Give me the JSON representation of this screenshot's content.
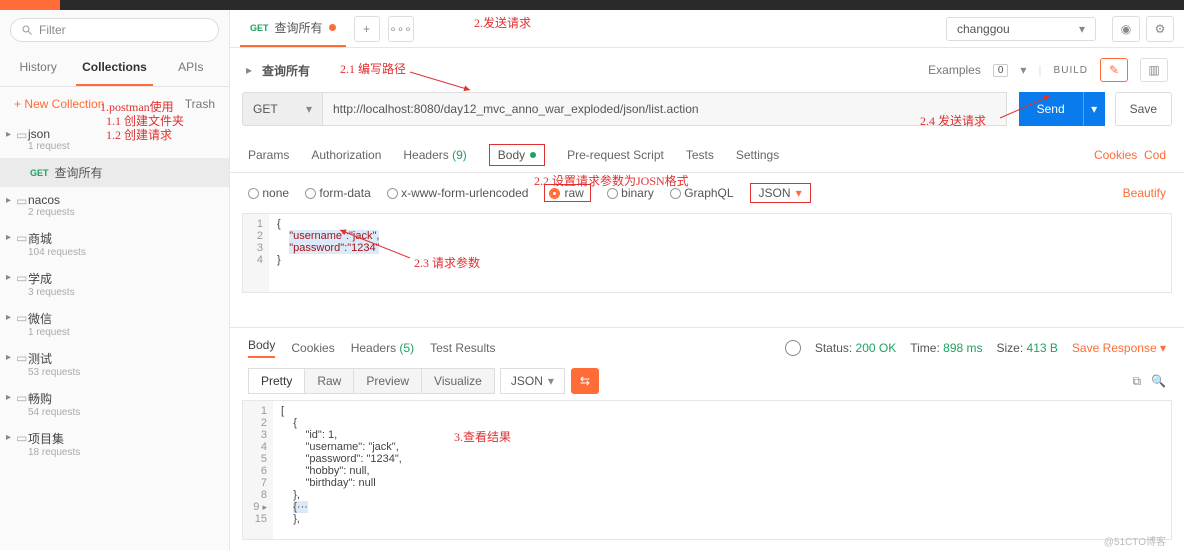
{
  "topbar": {},
  "sidebar": {
    "filter_placeholder": "Filter",
    "tabs": {
      "history": "History",
      "collections": "Collections",
      "apis": "APIs"
    },
    "new_collection": "+  New Collection",
    "trash": "Trash",
    "active_request": {
      "method": "GET",
      "name": "查询所有"
    },
    "collections": [
      {
        "name": "json",
        "sub": "1 request"
      },
      {
        "name": "nacos",
        "sub": "2 requests"
      },
      {
        "name": "商城",
        "sub": "104 requests"
      },
      {
        "name": "学成",
        "sub": "3 requests"
      },
      {
        "name": "微信",
        "sub": "1 request"
      },
      {
        "name": "测试",
        "sub": "53 requests"
      },
      {
        "name": "畅购",
        "sub": "54 requests"
      },
      {
        "name": "项目集",
        "sub": "18 requests"
      }
    ]
  },
  "tabstrip": {
    "tab_method": "GET",
    "tab_name": "查询所有",
    "workspace": "changgou"
  },
  "namebar": {
    "name": "查询所有",
    "examples": "Examples",
    "ex_count": "0",
    "build": "BUILD"
  },
  "urlrow": {
    "method": "GET",
    "url": "http://localhost:8080/day12_mvc_anno_war_exploded/json/list.action",
    "send": "Send",
    "save": "Save"
  },
  "reqtabs": {
    "params": "Params",
    "auth": "Authorization",
    "headers": "Headers",
    "headers_n": "(9)",
    "body": "Body",
    "pre": "Pre-request Script",
    "tests": "Tests",
    "settings": "Settings",
    "cookies": "Cookies",
    "code": "Cod"
  },
  "body_types": {
    "none": "none",
    "form_data": "form-data",
    "urlenc": "x-www-form-urlencoded",
    "raw": "raw",
    "binary": "binary",
    "graphql": "GraphQL",
    "json": "JSON",
    "beautify": "Beautify"
  },
  "req_body_code": {
    "l1": "{",
    "l2_k": "\"username\"",
    "l2_v": "\"jack\"",
    "l3_k": "\"password\"",
    "l3_v": "\"1234\"",
    "l4": "}"
  },
  "resp_hdr": {
    "body": "Body",
    "cookies": "Cookies",
    "headers": "Headers",
    "headers_n": "(5)",
    "tests": "Test Results",
    "status_lbl": "Status:",
    "status_val": "200 OK",
    "time_lbl": "Time:",
    "time_val": "898 ms",
    "size_lbl": "Size:",
    "size_val": "413 B",
    "save": "Save Response"
  },
  "resp_fmt": {
    "pretty": "Pretty",
    "raw": "Raw",
    "preview": "Preview",
    "visualize": "Visualize",
    "json": "JSON"
  },
  "resp_body": {
    "open": "[",
    "obj_open": "{",
    "id_k": "\"id\"",
    "id_v": "1",
    "un_k": "\"username\"",
    "un_v": "\"jack\"",
    "pw_k": "\"password\"",
    "pw_v": "\"1234\"",
    "hb_k": "\"hobby\"",
    "hb_v": "null",
    "bd_k": "\"birthday\"",
    "bd_v": "null",
    "obj_close": "},",
    "fold": "{···",
    "obj_close2": "},"
  },
  "annotations": {
    "a1": "1.postman使用",
    "a11": "1.1 创建文件夹",
    "a12": "1.2 创建请求",
    "a2": "2.发送请求",
    "a21": "2.1 编写路径",
    "a22": "2.2 设置请求参数为JOSN格式",
    "a23": "2.3 请求参数",
    "a24": "2.4 发送请求",
    "a3": "3.查看结果",
    "wm": "@51CTO博客"
  }
}
